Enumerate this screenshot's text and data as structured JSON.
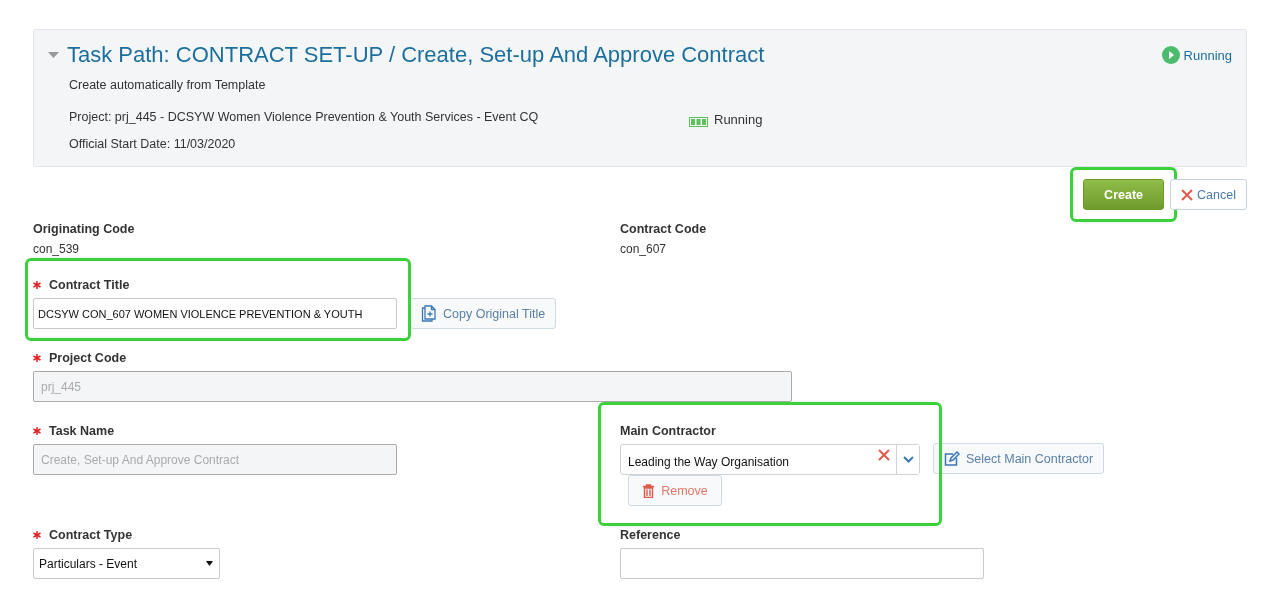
{
  "header": {
    "expanded": true,
    "title": "Task Path: CONTRACT SET-UP / Create, Set-up And Approve Contract",
    "status": "Running",
    "subtitle": "Create automatically from Template",
    "project": "Project: prj_445 - DCSYW Women Violence Prevention & Youth Services - Event CQ",
    "project_status": "Running",
    "start_date": "Official Start Date: 11/03/2020"
  },
  "actions": [
    {
      "kind": "primary",
      "label": "Create",
      "highlighted": true
    },
    {
      "kind": "cancel",
      "label": "Cancel",
      "highlighted": false
    }
  ],
  "rows": [
    [
      {
        "kind": "static",
        "label": "Originating Code",
        "required": false,
        "value": "con_539"
      },
      {
        "kind": "static",
        "label": "Contract Code",
        "required": false,
        "value": "con_607"
      }
    ],
    [
      {
        "kind": "text",
        "label": "Contract Title",
        "required": true,
        "value": "DCSYW CON_607 WOMEN VIOLENCE PREVENTION & YOUTH",
        "button": "Copy Original Title",
        "highlighted": true
      }
    ],
    [
      {
        "kind": "disabled_wide",
        "label": "Project Code",
        "required": true,
        "value": "prj_445"
      }
    ],
    [
      {
        "kind": "disabled",
        "label": "Task Name",
        "required": true,
        "value": "Create, Set-up And Approve Contract"
      },
      {
        "kind": "combo",
        "label": "Main Contractor",
        "required": false,
        "value": "Leading the Way Organisation",
        "button": "Select Main Contractor",
        "remove": "Remove",
        "highlighted": true
      }
    ],
    [
      {
        "kind": "select",
        "label": "Contract Type",
        "required": true,
        "value": "Particulars - Event"
      },
      {
        "kind": "input",
        "label": "Reference",
        "required": false
      }
    ]
  ]
}
